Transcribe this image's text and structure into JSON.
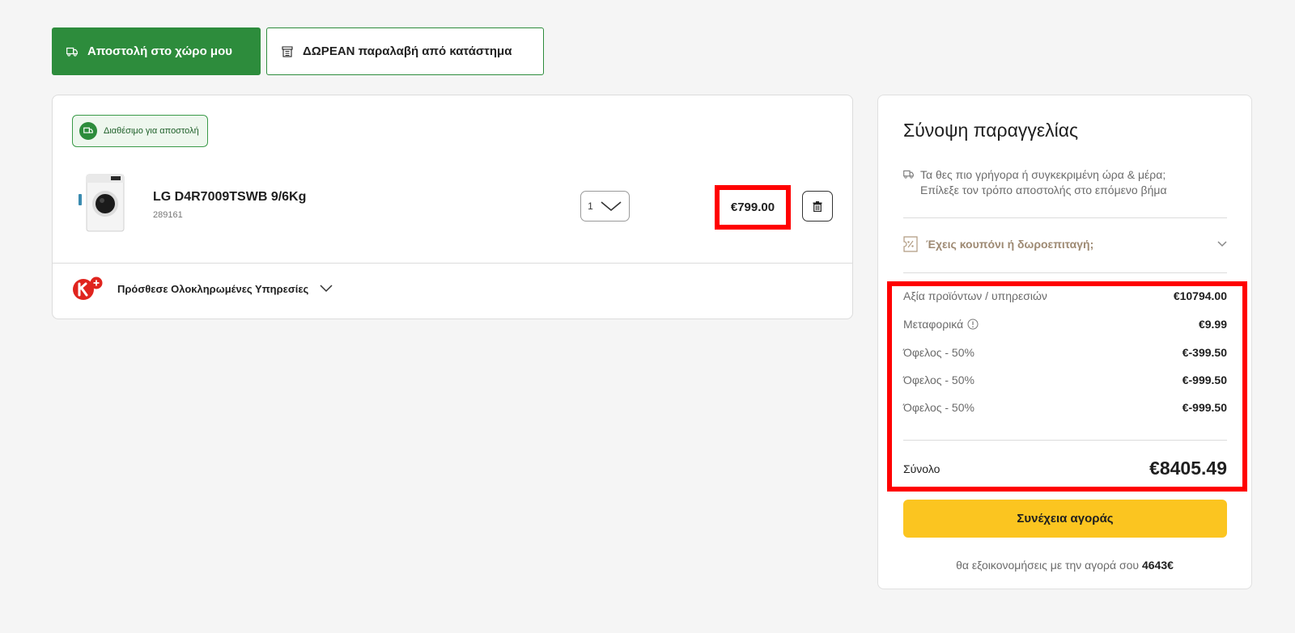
{
  "delivery_tabs": {
    "home_delivery": "Αποστολή στο χώρο μου",
    "store_pickup": "ΔΩΡΕΑΝ παραλαβή από κατάστημα"
  },
  "cart": {
    "availability_badge": "Διαθέσιμο για αποστολή",
    "item": {
      "name": "LG D4R7009TSWB 9/6Kg",
      "sku": "289161",
      "quantity": "1",
      "price": "€799.00"
    },
    "services_toggle": "Πρόσθεσε Ολοκληρωμένες Υπηρεσίες"
  },
  "summary": {
    "title": "Σύνοψη παραγγελίας",
    "delivery_note_line1": "Τα θες πιο γρήγορα ή συγκεκριμένη ώρα & μέρα;",
    "delivery_note_line2": "Επίλεξε τον τρόπο αποστολής στο επόμενο βήμα",
    "coupon_label": "Έχεις κουπόνι ή δωροεπιταγή;",
    "lines": [
      {
        "label": "Αξία προϊόντων / υπηρεσιών",
        "value": "€10794.00"
      },
      {
        "label": "Μεταφορικά",
        "value": "€9.99"
      },
      {
        "label": "Όφελος - 50%",
        "value": "€-399.50"
      },
      {
        "label": "Όφελος - 50%",
        "value": "€-999.50"
      },
      {
        "label": "Όφελος - 50%",
        "value": "€-999.50"
      }
    ],
    "total_label": "Σύνολο",
    "total_value": "€8405.49",
    "checkout_label": "Συνέχεια αγοράς",
    "savings_prefix": "θα εξοικονομήσεις με την αγορά σου",
    "savings_amount": "4643€"
  },
  "colors": {
    "primary_green": "#2d8c3c",
    "cta_yellow": "#fbc520",
    "highlight_red": "#ff0000"
  },
  "icons": {
    "delivery_tab": "truck-icon",
    "pickup_tab": "store-icon",
    "delete": "trash-icon",
    "services_logo": "kotsovolos-plus-logo",
    "coupon": "coupon-icon",
    "shipping_info": "info-icon"
  }
}
